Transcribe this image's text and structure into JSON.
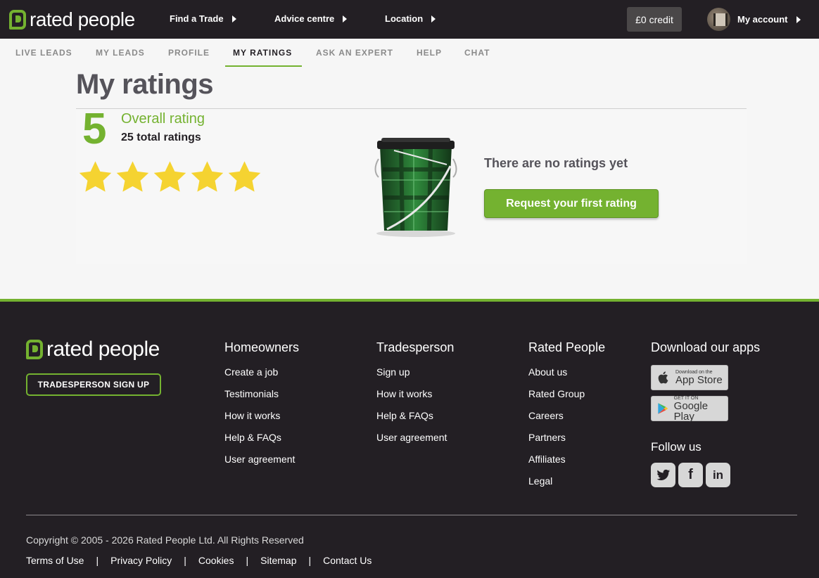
{
  "header": {
    "logo_text": "rated people",
    "nav": [
      "Find a Trade",
      "Advice centre",
      "Location"
    ],
    "credit": "£0 credit",
    "account": "My account"
  },
  "subnav": {
    "items": [
      "LIVE LEADS",
      "MY LEADS",
      "PROFILE",
      "MY RATINGS",
      "ASK AN EXPERT",
      "HELP",
      "CHAT"
    ],
    "active": "MY RATINGS"
  },
  "main": {
    "title": "My ratings",
    "score": "5",
    "overall_label": "Overall rating",
    "total_ratings": "25 total ratings",
    "stars": 5,
    "no_ratings_text": "There are no ratings yet",
    "request_button": "Request your first rating"
  },
  "footer": {
    "logo_text": "rated people",
    "signup_button": "TRADESPERSON SIGN UP",
    "columns": [
      {
        "heading": "Homeowners",
        "links": [
          "Create a job",
          "Testimonials",
          "How it works",
          "Help & FAQs",
          "User agreement"
        ]
      },
      {
        "heading": "Tradesperson",
        "links": [
          "Sign up",
          "How it works",
          "Help & FAQs",
          "User agreement"
        ]
      },
      {
        "heading": "Rated People",
        "links": [
          "About us",
          "Rated Group",
          "Careers",
          "Partners",
          "Affiliates",
          "Legal"
        ]
      }
    ],
    "apps_heading": "Download our apps",
    "app_store": {
      "small": "Download on the",
      "big": "App Store"
    },
    "google_play": {
      "small": "GET IT ON",
      "big": "Google Play"
    },
    "follow_heading": "Follow us",
    "social": [
      "twitter-icon",
      "facebook-icon",
      "linkedin-icon"
    ],
    "copyright": "Copyright © 2005 - 2026 Rated People Ltd. All Rights Reserved",
    "legal_links": [
      "Terms of Use",
      "Privacy Policy",
      "Cookies",
      "Sitemap",
      "Contact Us"
    ]
  },
  "colors": {
    "brand_green": "#74b230",
    "dark": "#231f24",
    "star": "#f5d331"
  }
}
